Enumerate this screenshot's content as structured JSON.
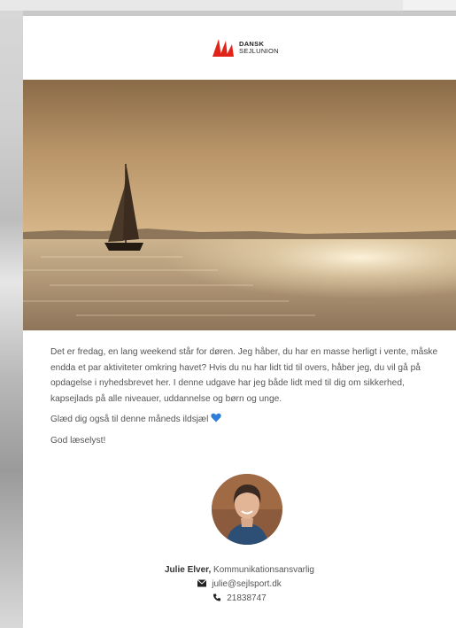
{
  "newsletter": {
    "logo": {
      "line1": "DANSK",
      "line2": "SEJLUNION"
    },
    "paragraphs": [
      "Det er fredag, en lang weekend står for døren. Jeg håber, du har en masse herligt i vente, måske endda et par aktiviteter omkring havet? Hvis du nu har lidt tid til overs, håber jeg, du vil gå på opdagelse i nyhedsbrevet her. I denne udgave har jeg både lidt med til dig om sikkerhed, kapsejlads på alle niveauer, uddannelse og børn og unge.",
      "Glæd dig også til denne måneds ildsjæl",
      "God læselyst!"
    ],
    "signature": {
      "name": "Julie Elver,",
      "role": " Kommunikationsansvarlig",
      "email": "julie@sejlsport.dk",
      "phone": "21838747"
    }
  },
  "colors": {
    "brand_red": "#e2231a",
    "heart_blue": "#2f7fd8",
    "text": "#555555"
  },
  "icons": {
    "heart": "blue-heart-icon",
    "email": "envelope-icon",
    "phone": "phone-icon"
  }
}
